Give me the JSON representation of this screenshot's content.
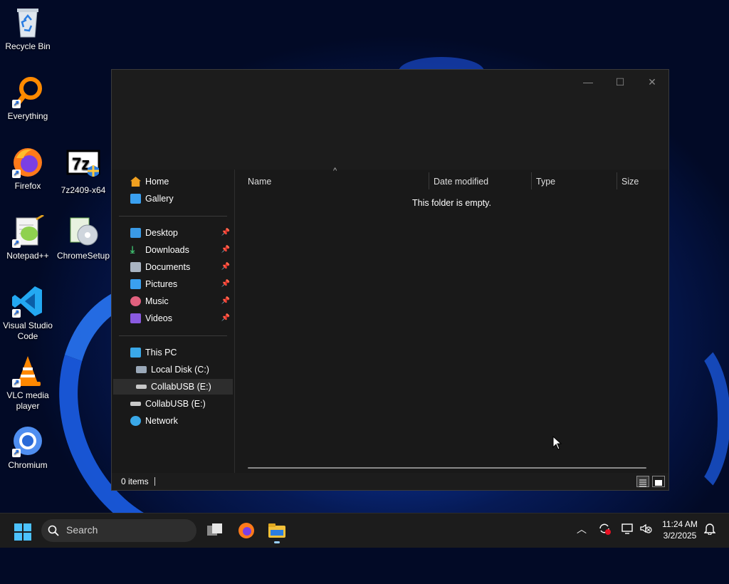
{
  "desktop": {
    "icons": [
      {
        "label": "Recycle Bin"
      },
      {
        "label": "Everything"
      },
      {
        "label": "Firefox"
      },
      {
        "label": "7z2409-x64"
      },
      {
        "label": "Notepad++"
      },
      {
        "label": "ChromeSetup"
      },
      {
        "label": "Visual Studio Code"
      },
      {
        "label": "VLC media player"
      },
      {
        "label": "Chromium"
      }
    ]
  },
  "window": {
    "controls": {
      "minimize": "—",
      "maximize": "☐",
      "close": "✕"
    },
    "sidebar": {
      "items": [
        {
          "label": "Home",
          "icon": "home-icon"
        },
        {
          "label": "Gallery",
          "icon": "gallery-icon"
        },
        {
          "label": "Desktop",
          "icon": "desktop-folder-icon",
          "pinned": true
        },
        {
          "label": "Downloads",
          "icon": "downloads-icon",
          "pinned": true
        },
        {
          "label": "Documents",
          "icon": "documents-icon",
          "pinned": true
        },
        {
          "label": "Pictures",
          "icon": "pictures-icon",
          "pinned": true
        },
        {
          "label": "Music",
          "icon": "music-icon",
          "pinned": true
        },
        {
          "label": "Videos",
          "icon": "videos-icon",
          "pinned": true
        },
        {
          "label": "This PC",
          "icon": "this-pc-icon"
        },
        {
          "label": "Local Disk (C:)",
          "icon": "local-disk-icon"
        },
        {
          "label": "CollabUSB (E:)",
          "icon": "usb-drive-icon",
          "selected": true
        },
        {
          "label": "CollabUSB (E:)",
          "icon": "usb-drive-icon"
        },
        {
          "label": "Network",
          "icon": "network-icon"
        }
      ],
      "pin_glyph": "📌"
    },
    "columns": [
      "Name",
      "Date modified",
      "Type",
      "Size"
    ],
    "sort_glyph": "^",
    "empty_message": "This folder is empty.",
    "status": {
      "item_count": "0 items"
    }
  },
  "taskbar": {
    "search_placeholder": "Search",
    "clock": {
      "time": "11:24 AM",
      "date": "3/2/2025"
    }
  },
  "colors": {
    "accent": "#0067c0",
    "window_bg": "#191919",
    "taskbar_bg": "#1c1c1c"
  }
}
